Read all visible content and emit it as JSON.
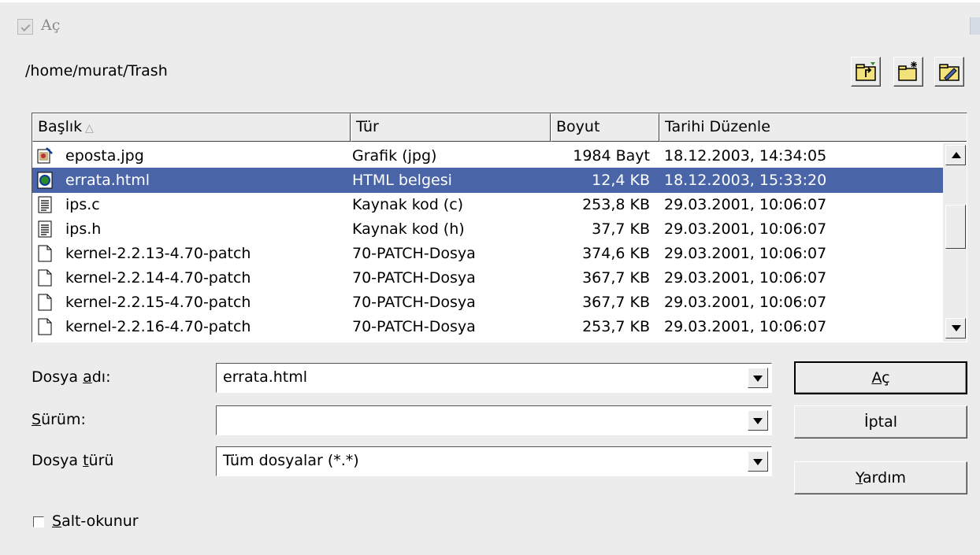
{
  "window": {
    "title": "Aç"
  },
  "path": "/home/murat/Trash",
  "toolbar": {
    "up_icon": "folder-up-icon",
    "new_icon": "new-folder-icon",
    "default_icon": "default-directory-icon"
  },
  "columns": {
    "name": "Başlık",
    "type": "Tür",
    "size": "Boyut",
    "date": "Tarihi Düzenle"
  },
  "files": [
    {
      "name": "eposta.jpg",
      "type": "Grafik (jpg)",
      "size": "1984 Bayt",
      "date": "18.12.2003, 14:34:05",
      "icon": "image-file-icon",
      "selected": false
    },
    {
      "name": "errata.html",
      "type": "HTML belgesi",
      "size": "12,4 KB",
      "date": "18.12.2003, 15:33:20",
      "icon": "html-file-icon",
      "selected": true
    },
    {
      "name": "ips.c",
      "type": "Kaynak kod (c)",
      "size": "253,8 KB",
      "date": "29.03.2001, 10:06:07",
      "icon": "text-file-icon",
      "selected": false
    },
    {
      "name": "ips.h",
      "type": "Kaynak kod (h)",
      "size": "37,7 KB",
      "date": "29.03.2001, 10:06:07",
      "icon": "text-file-icon",
      "selected": false
    },
    {
      "name": "kernel-2.2.13-4.70-patch",
      "type": "70-PATCH-Dosya",
      "size": "374,6 KB",
      "date": "29.03.2001, 10:06:07",
      "icon": "generic-file-icon",
      "selected": false
    },
    {
      "name": "kernel-2.2.14-4.70-patch",
      "type": "70-PATCH-Dosya",
      "size": "367,7 KB",
      "date": "29.03.2001, 10:06:07",
      "icon": "generic-file-icon",
      "selected": false
    },
    {
      "name": "kernel-2.2.15-4.70-patch",
      "type": "70-PATCH-Dosya",
      "size": "367,7 KB",
      "date": "29.03.2001, 10:06:07",
      "icon": "generic-file-icon",
      "selected": false
    },
    {
      "name": "kernel-2.2.16-4.70-patch",
      "type": "70-PATCH-Dosya",
      "size": "253,7 KB",
      "date": "29.03.2001, 10:06:07",
      "icon": "generic-file-icon",
      "selected": false
    }
  ],
  "form": {
    "filename": {
      "label_pre": "Dosya ",
      "label_key": "a",
      "label_post": "dı:",
      "value": "errata.html"
    },
    "version": {
      "label_pre": "",
      "label_key": "S",
      "label_post": "ürüm:",
      "value": ""
    },
    "filetype": {
      "label_pre": "Dosya ",
      "label_key": "t",
      "label_post": "ürü",
      "value": "Tüm dosyalar (*.*)"
    }
  },
  "buttons": {
    "open": {
      "key": "A",
      "rest": "ç"
    },
    "cancel": {
      "label": "İptal"
    },
    "help": {
      "key": "Y",
      "rest": "ardım"
    }
  },
  "readonly": {
    "key": "S",
    "rest": "alt-okunur",
    "checked": false
  },
  "colors": {
    "selection": "#4a64a8",
    "background": "#ececec"
  }
}
